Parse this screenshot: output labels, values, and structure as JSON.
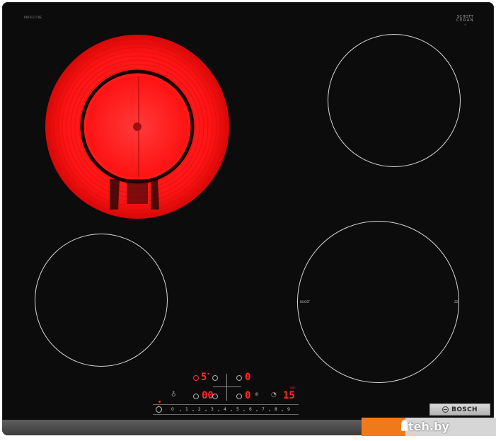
{
  "hob": {
    "model_code": "PKF631T8E",
    "schott_logo": {
      "line1": "SCHOTT",
      "line2": "CERAN",
      "line3": "®"
    },
    "zone_labels": {
      "boost": "BOOST",
      "right": "ZZ"
    }
  },
  "controls": {
    "top_row": {
      "display_left": "5",
      "display_left_small": "▪",
      "display_right": "0"
    },
    "bottom_row": {
      "display_left": "00",
      "display_right": "0",
      "timer": "15",
      "timer_small": "min"
    },
    "slider": {
      "values": [
        "0",
        "1",
        "2",
        "3",
        "4",
        "5",
        "6",
        "7",
        "8",
        "9"
      ]
    }
  },
  "brand": {
    "name": "BOSCH"
  },
  "watermark": {
    "text": "teh.by"
  },
  "colors": {
    "heat_red": "#ff1a1a",
    "glass_black": "#0c0c0c",
    "accent_orange": "#f07a1a"
  },
  "icons": [
    "hot-zone",
    "child-lock-icon",
    "power-icon",
    "timer-icon",
    "zone-select-icon"
  ]
}
